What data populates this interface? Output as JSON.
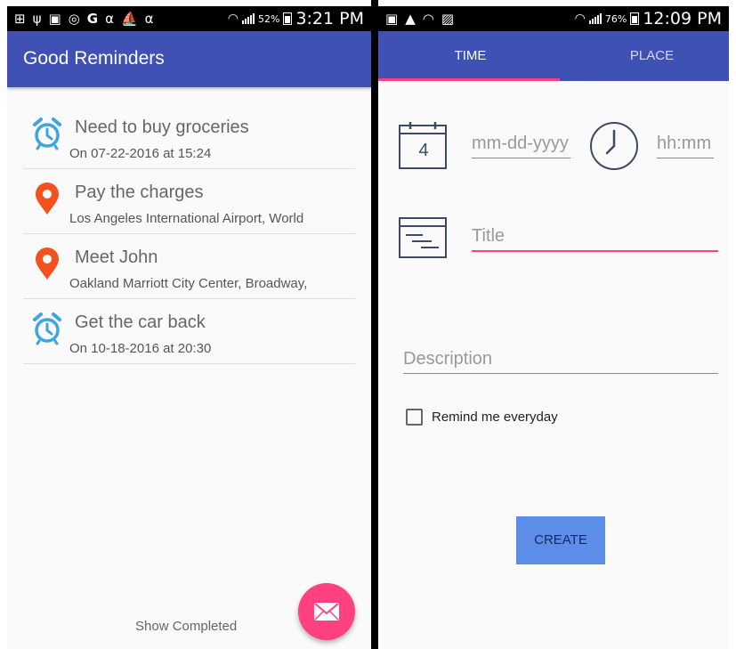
{
  "left_screen": {
    "status": {
      "icons": [
        "add-box-icon",
        "usb-icon",
        "no-sim-icon",
        "instagram-icon",
        "google-icon",
        "alpha-icon",
        "boat-icon",
        "alpha-icon"
      ],
      "battery": "52%",
      "time": "3:21 PM"
    },
    "app_title": "Good Reminders",
    "reminders": [
      {
        "icon": "alarm-clock-icon",
        "title": "Need to buy groceries",
        "subtitle": "On 07-22-2016 at 15:24"
      },
      {
        "icon": "map-pin-icon",
        "title": "Pay the charges",
        "subtitle": "Los Angeles International Airport, World"
      },
      {
        "icon": "map-pin-icon",
        "title": "Meet John",
        "subtitle": "Oakland Marriott City Center, Broadway,"
      },
      {
        "icon": "alarm-clock-icon",
        "title": "Get the car back",
        "subtitle": "On 10-18-2016 at 20:30"
      }
    ],
    "show_completed": "Show Completed",
    "fab_icon": "envelope-icon"
  },
  "right_screen": {
    "status": {
      "icons": [
        "no-sim-icon",
        "warning-icon",
        "wifi-icon",
        "image-icon"
      ],
      "battery": "76%",
      "time": "12:09 PM"
    },
    "tabs": [
      {
        "label": "TIME",
        "active": true
      },
      {
        "label": "PLACE",
        "active": false
      }
    ],
    "calendar_day": "4",
    "date_placeholder": "mm-dd-yyyy",
    "time_placeholder": "hh:mm",
    "title_placeholder": "Title",
    "description_placeholder": "Description",
    "remind_label": "Remind me everyday",
    "create_label": "CREATE"
  },
  "colors": {
    "primary": "#3f51b5",
    "accent": "#ff4081",
    "alarm_blue": "#3da5e0",
    "pin_orange": "#f4511e",
    "button_blue": "#5c8de8"
  }
}
